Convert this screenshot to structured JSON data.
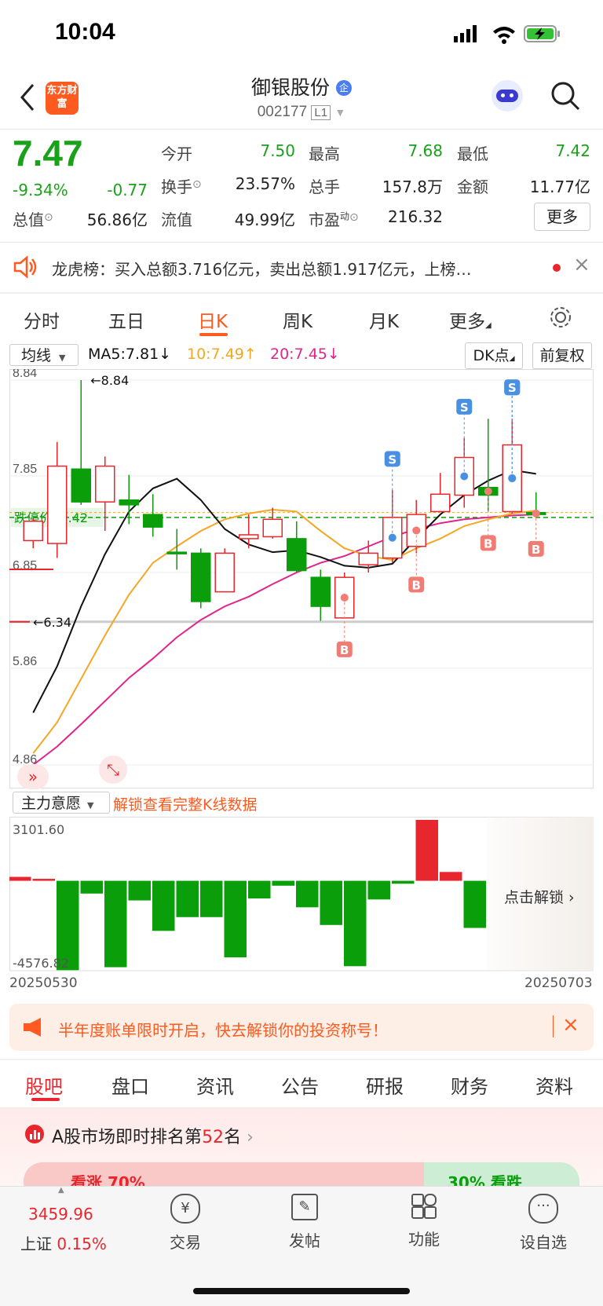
{
  "status": {
    "time": "10:04"
  },
  "header": {
    "logo_text": "东方财富",
    "stock_name": "御银股份",
    "stock_code": "002177",
    "level_badge": "L1",
    "enterprise_badge": "企"
  },
  "quote": {
    "price": "7.47",
    "change_pct": "-9.34%",
    "change": "-0.77",
    "open_label": "今开",
    "open": "7.50",
    "high_label": "最高",
    "high": "7.68",
    "low_label": "最低",
    "low": "7.42",
    "turnover_label": "换手",
    "turnover": "23.57%",
    "volume_label": "总手",
    "volume": "157.8万",
    "amount_label": "金额",
    "amount": "11.77亿",
    "mktcap_label": "总值",
    "mktcap": "56.86亿",
    "float_label": "流值",
    "float": "49.99亿",
    "pe_label": "市盈",
    "pe_sup": "动",
    "pe": "216.32",
    "more_label": "更多"
  },
  "news": {
    "text": "龙虎榜：买入总额3.716亿元，卖出总额1.917亿元，上榜…"
  },
  "chart_tabs": [
    "分时",
    "五日",
    "日K",
    "周K",
    "月K",
    "更多"
  ],
  "chart_toolbar": {
    "ma_select": "均线",
    "ma5": "MA5:7.81",
    "ma10": "10:7.49",
    "ma20": "20:7.45",
    "dk_label": "DK点",
    "adjust_label": "前复权"
  },
  "colors": {
    "up": "#e8262d",
    "down": "#0a9e0a",
    "ma5": "#111111",
    "ma10": "#f5a623",
    "ma20": "#e0248b",
    "accent": "#ff5a1f"
  },
  "chart_data": [
    {
      "type": "candlestick",
      "y_ticks": [
        "8.84",
        "7.85",
        "6.85",
        "5.86",
        "4.86"
      ],
      "ylim": [
        4.86,
        8.84
      ],
      "max_marker": "8.84",
      "min_marker": "6.34",
      "limit_down_label": "跌停价: 7.42",
      "candles": [
        {
          "o": 7.18,
          "c": 7.38,
          "h": 7.41,
          "l": 7.1
        },
        {
          "o": 7.15,
          "c": 7.95,
          "h": 8.2,
          "l": 7.0
        },
        {
          "o": 7.92,
          "c": 7.58,
          "h": 8.84,
          "l": 7.55
        },
        {
          "o": 7.58,
          "c": 7.95,
          "h": 8.05,
          "l": 7.28
        },
        {
          "o": 7.6,
          "c": 7.55,
          "h": 7.86,
          "l": 7.35
        },
        {
          "o": 7.45,
          "c": 7.32,
          "h": 7.66,
          "l": 7.22
        },
        {
          "o": 7.06,
          "c": 7.05,
          "h": 7.3,
          "l": 6.88
        },
        {
          "o": 7.05,
          "c": 6.55,
          "h": 7.1,
          "l": 6.48
        },
        {
          "o": 6.65,
          "c": 7.05,
          "h": 7.1,
          "l": 6.65
        },
        {
          "o": 7.2,
          "c": 7.24,
          "h": 7.45,
          "l": 7.1
        },
        {
          "o": 7.22,
          "c": 7.4,
          "h": 7.52,
          "l": 7.2
        },
        {
          "o": 7.2,
          "c": 6.87,
          "h": 7.38,
          "l": 6.85
        },
        {
          "o": 6.8,
          "c": 6.5,
          "h": 6.88,
          "l": 6.35
        },
        {
          "o": 6.38,
          "c": 6.8,
          "h": 6.85,
          "l": 6.38
        },
        {
          "o": 6.93,
          "c": 7.05,
          "h": 7.18,
          "l": 6.85
        },
        {
          "o": 7.0,
          "c": 7.42,
          "h": 7.7,
          "l": 6.95
        },
        {
          "o": 7.12,
          "c": 7.45,
          "h": 7.6,
          "l": 7.05
        },
        {
          "o": 7.48,
          "c": 7.66,
          "h": 7.88,
          "l": 7.48
        },
        {
          "o": 7.65,
          "c": 8.04,
          "h": 8.24,
          "l": 7.52
        },
        {
          "o": 7.73,
          "c": 7.65,
          "h": 8.44,
          "l": 7.48
        },
        {
          "o": 7.48,
          "c": 8.17,
          "h": 8.44,
          "l": 7.46
        },
        {
          "o": 7.47,
          "c": 7.45,
          "h": 7.68,
          "l": 7.42
        }
      ],
      "ma5": [
        5.4,
        5.88,
        6.5,
        7.04,
        7.48,
        7.72,
        7.82,
        7.6,
        7.3,
        7.14,
        7.06,
        7.08,
        7.01,
        6.92,
        6.9,
        6.94,
        7.2,
        7.45,
        7.65,
        7.8,
        7.91,
        7.87
      ],
      "ma10": [
        4.98,
        5.3,
        5.75,
        6.2,
        6.62,
        6.95,
        7.12,
        7.28,
        7.4,
        7.46,
        7.5,
        7.48,
        7.28,
        7.1,
        7.02,
        6.98,
        7.1,
        7.2,
        7.33,
        7.4,
        7.46,
        7.49
      ],
      "ma20": [
        4.86,
        5.05,
        5.28,
        5.52,
        5.76,
        5.96,
        6.18,
        6.36,
        6.5,
        6.6,
        6.73,
        6.85,
        6.95,
        7.02,
        7.12,
        7.22,
        7.3,
        7.36,
        7.4,
        7.42,
        7.44,
        7.45
      ],
      "signals": [
        {
          "i": 13,
          "type": "B"
        },
        {
          "i": 15,
          "type": "S"
        },
        {
          "i": 16,
          "type": "B"
        },
        {
          "i": 18,
          "type": "S"
        },
        {
          "i": 19,
          "type": "B"
        },
        {
          "i": 20,
          "type": "S"
        },
        {
          "i": 20,
          "type": "S"
        },
        {
          "i": 21,
          "type": "B"
        }
      ]
    },
    {
      "type": "bar",
      "title": "主力意愿",
      "ylim": [
        -4576.82,
        3101.6
      ],
      "y_ticks": [
        "3101.60",
        "-4576.82"
      ],
      "x_start": "20250530",
      "x_end": "20250703",
      "values": [
        200,
        100,
        -4550,
        -650,
        -4400,
        -1000,
        -2550,
        -1850,
        -1850,
        -3900,
        -900,
        -250,
        -1350,
        -2250,
        -4350,
        -950,
        -150,
        3101.6,
        450,
        -2400
      ],
      "unlock_label": "点击解锁",
      "unlock_text": "解锁查看完整K线数据"
    }
  ],
  "promo": {
    "text": "半年度账单限时开启，快去解锁你的投资称号！"
  },
  "bottom_tabs": [
    "股吧",
    "盘口",
    "资讯",
    "公告",
    "研报",
    "财务",
    "资料"
  ],
  "ranking": {
    "prefix": "A股市场即时排名第",
    "rank": "52",
    "suffix": "名",
    "bull_label": "看涨 70%",
    "bear_label": "30% 看跌"
  },
  "index": {
    "value": "3459.96",
    "name": "上证",
    "pct": "0.15%"
  },
  "nav": [
    "交易",
    "发帖",
    "功能",
    "设自选"
  ]
}
